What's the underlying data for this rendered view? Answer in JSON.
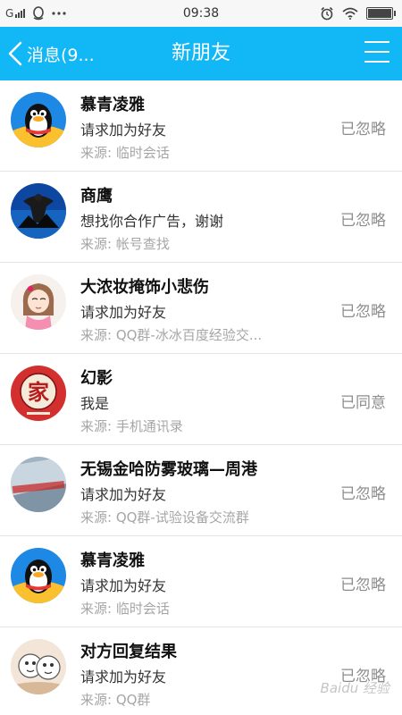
{
  "status_bar": {
    "carrier": "G",
    "time": "09:38",
    "icons": [
      "signal-bars-icon",
      "qq-icon",
      "more-dots-icon",
      "alarm-icon",
      "wifi-icon",
      "battery-icon"
    ]
  },
  "header": {
    "back_label": "消息(9...",
    "title": "新朋友",
    "menu_icon": "menu-icon"
  },
  "requests": [
    {
      "name": "慕青凌雅",
      "message": "请求加为好友",
      "source": "来源: 临时会话",
      "status": "已忽略",
      "avatar": "penguin"
    },
    {
      "name": "商鹰",
      "message": "想找你合作广告，谢谢",
      "source": "来源: 帐号查找",
      "status": "已忽略",
      "avatar": "eagle"
    },
    {
      "name": "大浓妆掩饰小悲伤",
      "message": "请求加为好友",
      "source": "来源: QQ群-冰冰百度经验交...",
      "status": "已忽略",
      "avatar": "cartoon-girl"
    },
    {
      "name": "幻影",
      "message": "我是",
      "source": "来源: 手机通讯录",
      "status": "已同意",
      "avatar": "family-seal",
      "avatar_text": "家"
    },
    {
      "name": "无锡金哈防雾玻璃—周港",
      "message": "请求加为好友",
      "source": "来源: QQ群-试验设备交流群",
      "status": "已忽略",
      "avatar": "glass"
    },
    {
      "name": "慕青凌雅",
      "message": "请求加为好友",
      "source": "来源: 临时会话",
      "status": "已忽略",
      "avatar": "penguin"
    },
    {
      "name": "对方回复结果",
      "message": "请求加为好友",
      "source": "来源: QQ群",
      "status": "已忽略",
      "avatar": "sketch"
    }
  ],
  "watermark": "Baidu 经验",
  "colors": {
    "accent": "#12b7f5",
    "muted": "#a6a6a6"
  }
}
